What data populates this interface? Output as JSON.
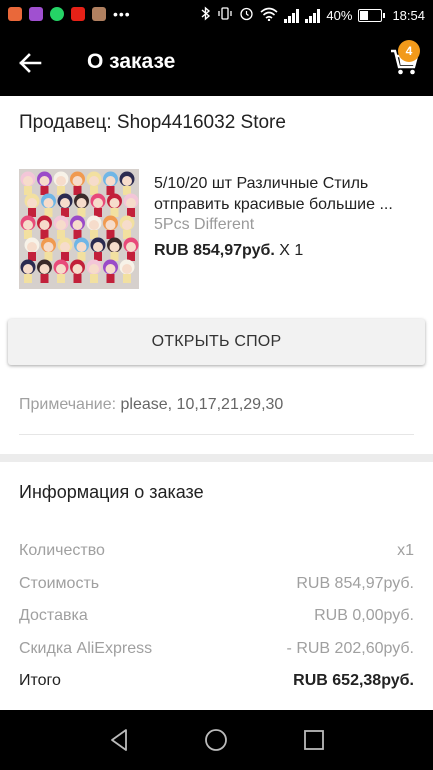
{
  "status_bar": {
    "battery_percent": "40%",
    "battery_level": 0.4,
    "time": "18:54",
    "app_icons": [
      {
        "name": "notification-app-icon",
        "color": "#e9683a"
      },
      {
        "name": "notification-app-icon",
        "color": "#a050d0"
      },
      {
        "name": "whatsapp-icon",
        "color": "#25d366"
      },
      {
        "name": "youtube-icon",
        "color": "#e62117"
      },
      {
        "name": "notification-app-icon",
        "color": "#b08060"
      }
    ],
    "overflow_dots": "•••"
  },
  "app_bar": {
    "title": "О заказе",
    "cart_count": "4",
    "accent_color": "#f29a1a"
  },
  "order": {
    "seller_label": "Продавец: Shop4416032 Store",
    "product": {
      "title_line1": "5/10/20 шт Различные Стиль",
      "title_line2": "отправить красивые большие ...",
      "variant": "5Pcs Different",
      "price": "RUB 854,97руб.",
      "quantity": "X 1"
    },
    "dispute_button": "ОТКРЫТЬ СПОР",
    "note_label": "Примечание:",
    "note_value": "please, 10,17,21,29,30"
  },
  "info": {
    "title": "Информация о заказе",
    "rows": [
      {
        "label": "Количество",
        "value": "x1"
      },
      {
        "label": "Стоимость",
        "value": "RUB 854,97руб."
      },
      {
        "label": "Доставка",
        "value": "RUB 0,00руб."
      },
      {
        "label": "Скидка AliExpress",
        "value": "- RUB 202,60руб."
      },
      {
        "label": "Итого",
        "value": "RUB 652,38руб."
      }
    ]
  }
}
